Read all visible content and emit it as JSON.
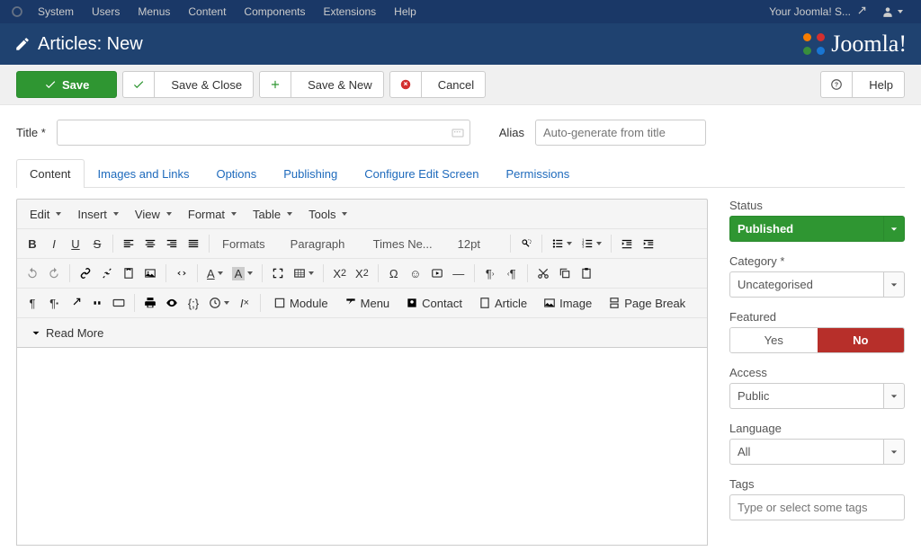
{
  "topbar": {
    "menus": [
      "System",
      "Users",
      "Menus",
      "Content",
      "Components",
      "Extensions",
      "Help"
    ],
    "site_name": "Your Joomla! S..."
  },
  "header": {
    "title": "Articles: New",
    "brand": "Joomla!"
  },
  "toolbar": {
    "save": "Save",
    "save_close": "Save & Close",
    "save_new": "Save & New",
    "cancel": "Cancel",
    "help": "Help"
  },
  "form": {
    "title_label": "Title",
    "title_value": "",
    "alias_label": "Alias",
    "alias_placeholder": "Auto-generate from title"
  },
  "tabs": [
    "Content",
    "Images and Links",
    "Options",
    "Publishing",
    "Configure Edit Screen",
    "Permissions"
  ],
  "active_tab": 0,
  "editor": {
    "menus": [
      "Edit",
      "Insert",
      "View",
      "Format",
      "Table",
      "Tools"
    ],
    "formats_select": "Formats",
    "block_select": "Paragraph",
    "font_select": "Times Ne...",
    "size_select": "12pt",
    "module_btn": "Module",
    "menu_btn": "Menu",
    "contact_btn": "Contact",
    "article_btn": "Article",
    "image_btn": "Image",
    "pagebreak_btn": "Page Break",
    "readmore_btn": "Read More"
  },
  "sidebar": {
    "status_label": "Status",
    "status_value": "Published",
    "category_label": "Category",
    "category_value": "Uncategorised",
    "featured_label": "Featured",
    "featured_yes": "Yes",
    "featured_no": "No",
    "access_label": "Access",
    "access_value": "Public",
    "language_label": "Language",
    "language_value": "All",
    "tags_label": "Tags",
    "tags_placeholder": "Type or select some tags"
  }
}
